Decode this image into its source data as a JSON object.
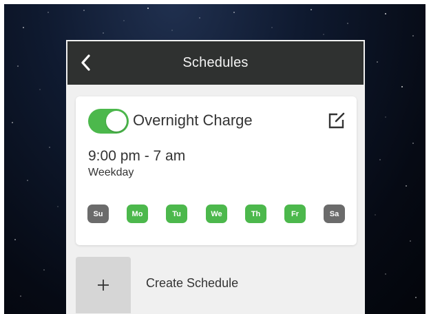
{
  "header": {
    "title": "Schedules",
    "back_icon": "chevron-left-icon"
  },
  "schedule": {
    "enabled": true,
    "name": "Overnight Charge",
    "time": "9:00 pm - 7 am",
    "repeat": "Weekday",
    "edit_icon": "edit-icon",
    "days": [
      {
        "label": "Su",
        "active": false
      },
      {
        "label": "Mo",
        "active": true
      },
      {
        "label": "Tu",
        "active": true
      },
      {
        "label": "We",
        "active": true
      },
      {
        "label": "Th",
        "active": true
      },
      {
        "label": "Fr",
        "active": true
      },
      {
        "label": "Sa",
        "active": false
      }
    ]
  },
  "create": {
    "label": "Create Schedule",
    "icon": "plus-icon"
  },
  "colors": {
    "active_green": "#4cb84c",
    "inactive_gray": "#6b6b6b",
    "navbar": "#2f3130"
  }
}
